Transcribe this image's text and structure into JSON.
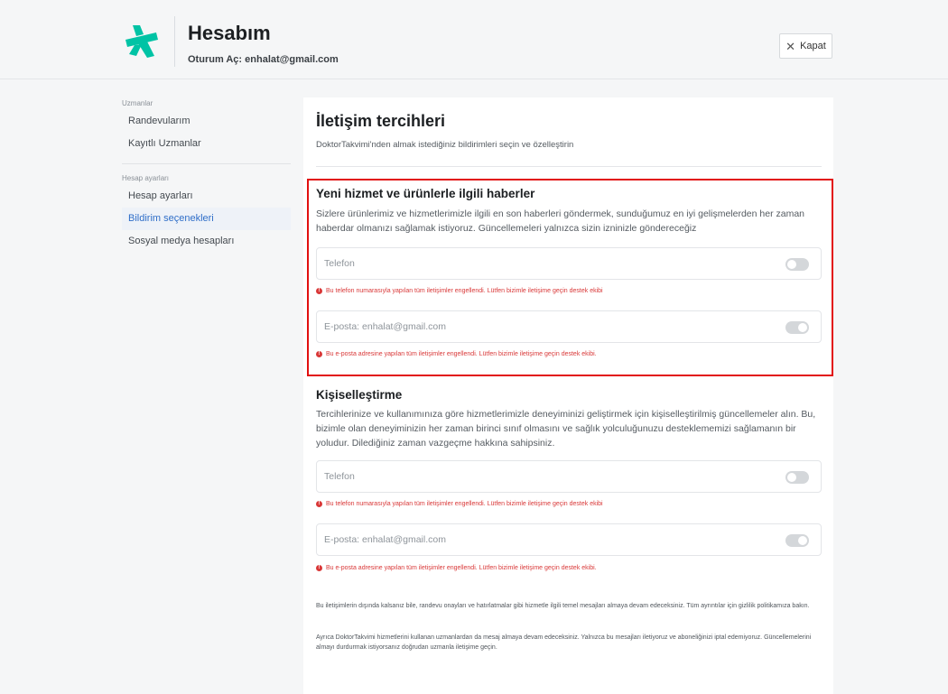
{
  "header": {
    "title": "Hesabım",
    "subtitle": "Oturum Aç: enhalat@gmail.com",
    "close_label": "Kapat",
    "brand_color": "#00c3a5"
  },
  "sidebar": {
    "section1": "Uzmanlar",
    "items1": [
      {
        "label": "Randevularım"
      },
      {
        "label": "Kayıtlı Uzmanlar"
      }
    ],
    "section2": "Hesap ayarları",
    "items2": [
      {
        "label": "Hesap ayarları",
        "active": false
      },
      {
        "label": "Bildirim seçenekleri",
        "active": true
      },
      {
        "label": "Sosyal medya hesapları",
        "active": false
      }
    ]
  },
  "main": {
    "title": "İletişim tercihleri",
    "subtitle": "DoktorTakvimi'nden almak istediğiniz bildirimleri seçin ve özelleştirin",
    "news": {
      "title": "Yeni hizmet ve ürünlerle ilgili haberler",
      "desc": "Sizlere ürünlerimiz ve hizmetlerimizle ilgili en son haberleri göndermek, sunduğumuz en iyi gelişmelerden her zaman haberdar olmanızı sağlamak istiyoruz. Güncellemeleri yalnızca sizin izninizle göndereceğiz",
      "phone_label": "Telefon",
      "phone_on": false,
      "phone_error": "Bu telefon numarasıyla yapılan tüm iletişimler engellendi. Lütfen bizimle iletişime geçin destek ekibi",
      "email_label": "E-posta: enhalat@gmail.com",
      "email_on": true,
      "email_error": "Bu e-posta adresine yapılan tüm iletişimler engellendi. Lütfen bizimle iletişime geçin destek ekibi."
    },
    "personal": {
      "title": "Kişiselleştirme",
      "desc": "Tercihlerinize ve kullanımınıza göre hizmetlerimizle deneyiminizi geliştirmek için kişiselleştirilmiş güncellemeler alın. Bu, bizimle olan deneyiminizin her zaman birinci sınıf olmasını ve sağlık yolculuğunuzu desteklememizi sağlamanın bir yoludur. Dilediğiniz zaman vazgeçme hakkına sahipsiniz.",
      "phone_label": "Telefon",
      "phone_on": false,
      "phone_error": "Bu telefon numarasıyla yapılan tüm iletişimler engellendi. Lütfen bizimle iletişime geçin destek ekibi",
      "email_label": "E-posta: enhalat@gmail.com",
      "email_on": true,
      "email_error": "Bu e-posta adresine yapılan tüm iletişimler engellendi. Lütfen bizimle iletişime geçin destek ekibi."
    },
    "footnote1": "Bu iletişimlerin dışında kalsanız bile, randevu onayları ve hatırlatmalar gibi hizmetle ilgili temel mesajları almaya devam edeceksiniz. Tüm ayrıntılar için gizlilik politikamıza bakın.",
    "footnote2": "Ayrıca DoktorTakvimi hizmetlerini kullanan uzmanlardan da mesaj almaya devam edeceksiniz. Yalnızca bu mesajları iletiyoruz ve aboneliğinizi iptal edemiyoruz. Güncellemelerini almayı durdurmak istiyorsanız doğrudan uzmanla iletişime geçin."
  }
}
